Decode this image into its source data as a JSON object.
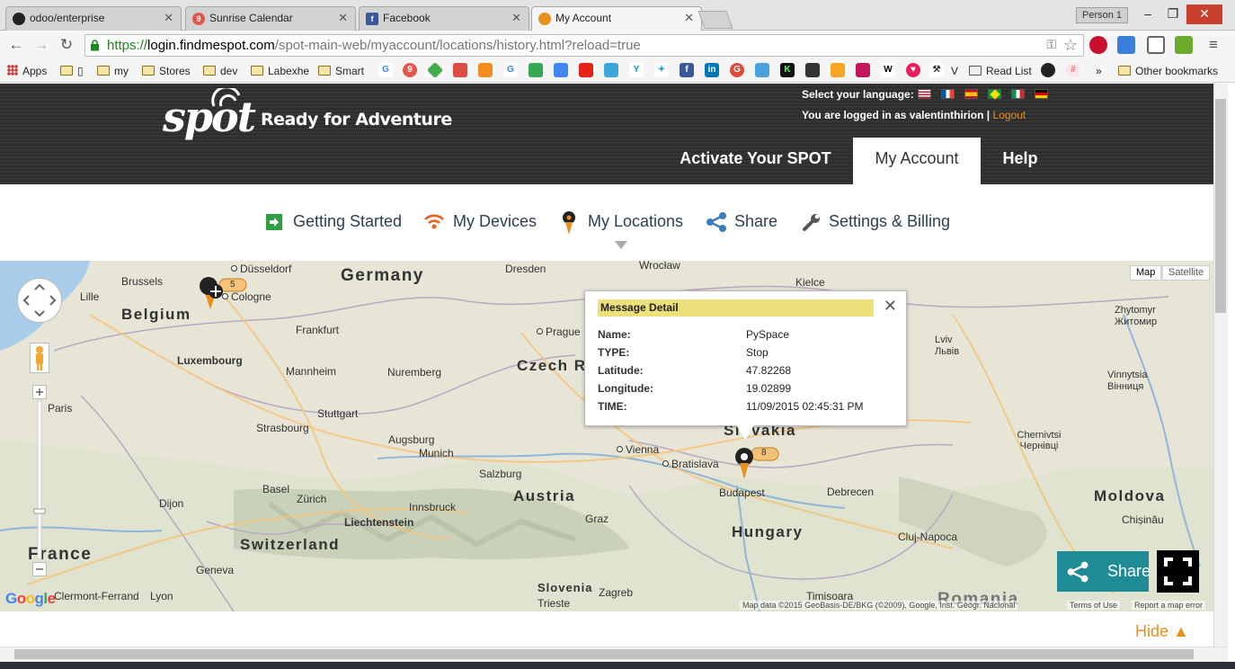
{
  "browser": {
    "tabs": [
      {
        "title": "odoo/enterprise",
        "icon": "github-icon"
      },
      {
        "title": "Sunrise Calendar",
        "icon": "sunrise-icon",
        "badge": "9"
      },
      {
        "title": "Facebook",
        "icon": "facebook-icon"
      },
      {
        "title": "My Account",
        "icon": "spot-icon",
        "active": true
      }
    ],
    "profile": "Person 1",
    "url": {
      "scheme": "https://",
      "host": "login.findmespot.com",
      "path": "/spot-main-web/myaccount/locations/history.html?reload=true"
    },
    "bookmarks": [
      "Apps",
      "my",
      "Stores",
      "dev",
      "Labexhe",
      "Smart",
      "V",
      "Read List",
      "Other bookmarks"
    ],
    "bookmark_overflow": "»"
  },
  "header": {
    "tagline": "Ready for Adventure",
    "language_label": "Select your language:",
    "login_text": "You are logged in as valentinthirion |",
    "logout_label": "Logout",
    "main_nav": [
      {
        "label": "Activate Your SPOT",
        "active": false
      },
      {
        "label": "My Account",
        "active": true
      },
      {
        "label": "Help",
        "active": false
      }
    ]
  },
  "subnav": [
    {
      "label": "Getting Started",
      "icon": "arrow-right-icon"
    },
    {
      "label": "My Devices",
      "icon": "wifi-signal-icon"
    },
    {
      "label": "My Locations",
      "icon": "location-pin-icon",
      "active": true
    },
    {
      "label": "Share",
      "icon": "share-icon"
    },
    {
      "label": "Settings & Billing",
      "icon": "wrench-icon"
    }
  ],
  "map": {
    "map_type": [
      "Map",
      "Satellite"
    ],
    "countries": [
      "Germany",
      "Belgium",
      "Luxembourg",
      "Czech R",
      "Austria",
      "Switzerland",
      "Liechtenstein",
      "France",
      "Slovenia",
      "Hungary",
      "Moldova",
      "Slovakia"
    ],
    "cities": [
      "Brussels",
      "Lille",
      "Düsseldorf",
      "Cologne",
      "Dresden",
      "Wrocław",
      "Kielce",
      "Frankfurt",
      "Prague",
      "Mannheim",
      "Nuremberg",
      "Stuttgart",
      "Strasbourg",
      "Augsburg",
      "Munich",
      "Basel",
      "Zürich",
      "Dijon",
      "Paris",
      "Salzburg",
      "Innsbruck",
      "Vienna",
      "Bratislava",
      "Budapest",
      "Graz",
      "Geneva",
      "Lyon",
      "Clermont-Ferrand",
      "Trieste",
      "Zagreb",
      "Debrecen",
      "Cluj-Napoca",
      "Timisoara",
      "Chernivtsi Чернівці",
      "Chișinău",
      "Lviv Львів",
      "Vinnytsia Вінниця",
      "Zhytomyr Житомир",
      "Romania"
    ],
    "cluster_counts": [
      "5",
      "8"
    ],
    "attribution": "Map data ©2015 GeoBasis-DE/BKG (©2009), Google, Inst. Geogr. Nacional",
    "terms": "Terms of Use",
    "report": "Report a map error",
    "google_logo": "Google"
  },
  "popup": {
    "title": "Message Detail",
    "rows": [
      {
        "key": "Name:",
        "value": "PySpace"
      },
      {
        "key": "TYPE:",
        "value": "Stop"
      },
      {
        "key": "Latitude:",
        "value": "47.82268"
      },
      {
        "key": "Longitude:",
        "value": "19.02899"
      },
      {
        "key": "TIME:",
        "value": "11/09/2015 02:45:31 PM"
      }
    ]
  },
  "share_button": "Share",
  "hide_label": "Hide ▲",
  "colors": {
    "accent": "#e8901a",
    "share": "#1e8b95",
    "popup_title": "#ebe07a"
  }
}
